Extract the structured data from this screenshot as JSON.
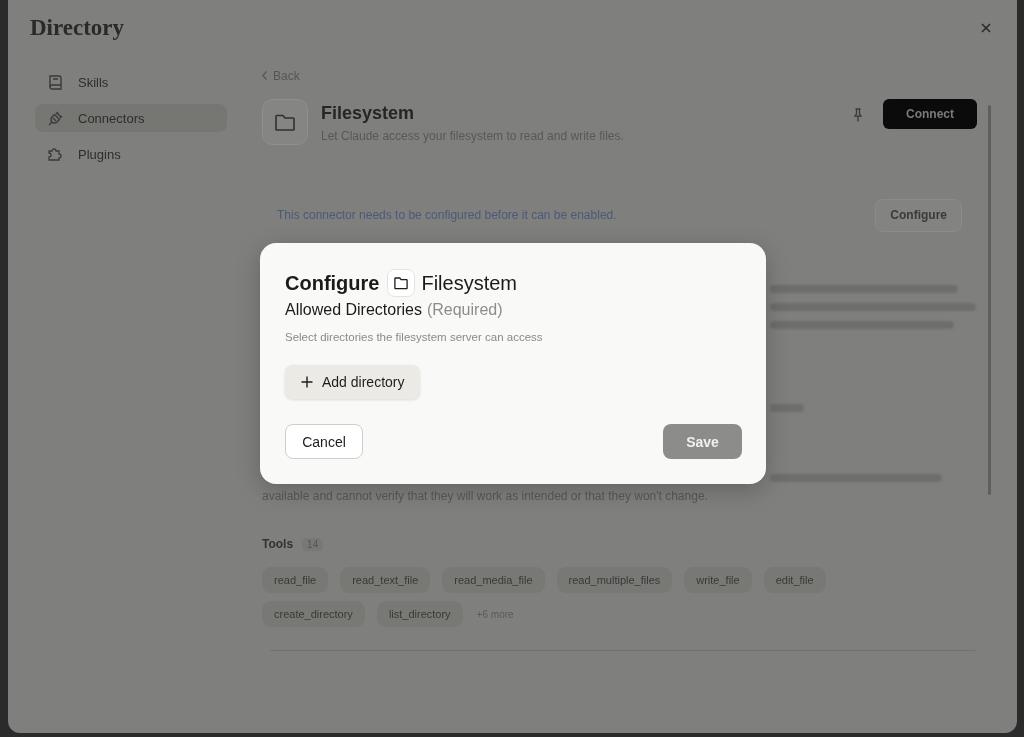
{
  "window": {
    "title": "Directory"
  },
  "sidebar": {
    "items": [
      {
        "label": "Skills",
        "selected": false
      },
      {
        "label": "Connectors",
        "selected": true
      },
      {
        "label": "Plugins",
        "selected": false
      }
    ]
  },
  "connector": {
    "back": "Back",
    "name": "Filesystem",
    "description": "Let Claude access your filesystem to read and write files.",
    "connect_button": "Connect",
    "notice": "This connector needs to be configured before it can be enabled.",
    "configure_button": "Configure",
    "description_tail": "available and cannot verify that they will work as intended or that they won't change.",
    "tools": {
      "label": "Tools",
      "count": "14",
      "items": [
        "read_file",
        "read_text_file",
        "read_media_file",
        "read_multiple_files",
        "write_file",
        "edit_file",
        "create_directory",
        "list_directory"
      ],
      "more": "+6 more"
    }
  },
  "dialog": {
    "title": "Configure",
    "connector": "Filesystem",
    "field_label": "Allowed Directories",
    "required_note": "(Required)",
    "hint": "Select directories the filesystem server can access",
    "add_button": "Add directory",
    "cancel_button": "Cancel",
    "save_button": {
      "label": "Save",
      "disabled": true
    }
  }
}
